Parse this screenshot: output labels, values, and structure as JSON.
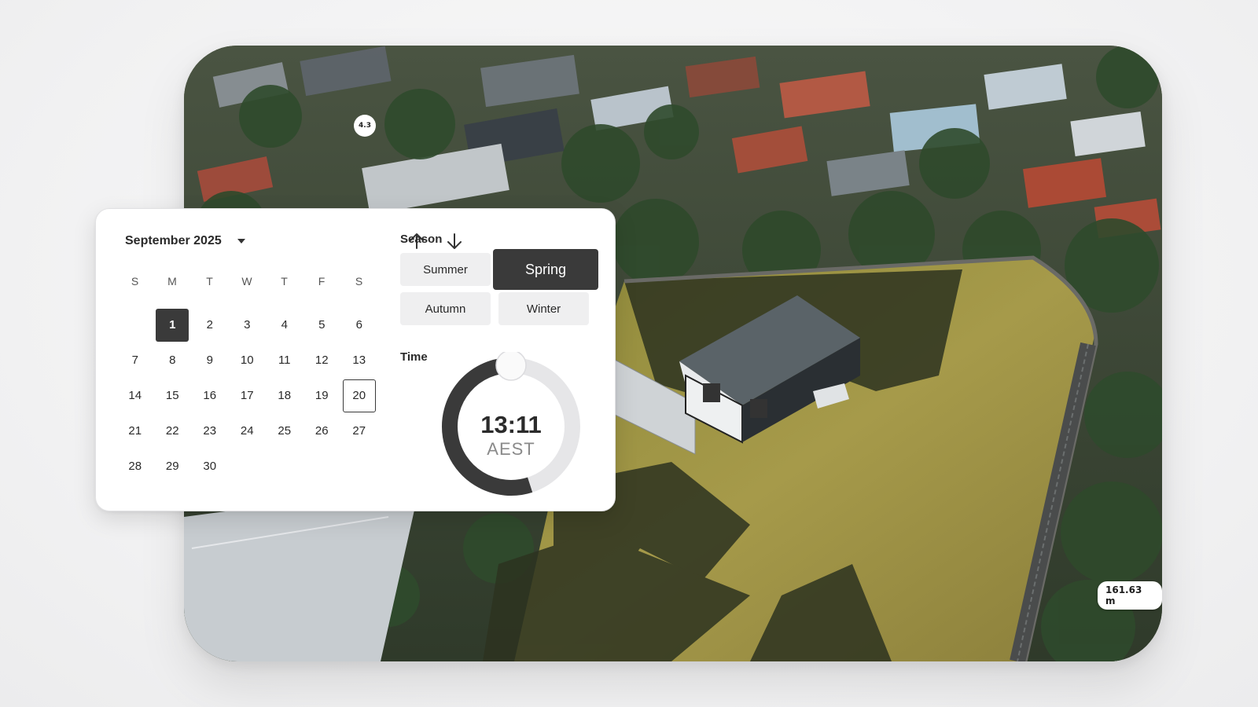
{
  "map": {
    "scale_label": "161.63 m",
    "marker_label": "4.3"
  },
  "calendar": {
    "month_label": "September 2025",
    "weekdays": [
      "S",
      "M",
      "T",
      "W",
      "T",
      "F",
      "S"
    ],
    "leading_blanks": 1,
    "days": [
      "1",
      "2",
      "3",
      "4",
      "5",
      "6",
      "7",
      "8",
      "9",
      "10",
      "11",
      "12",
      "13",
      "14",
      "15",
      "16",
      "17",
      "18",
      "19",
      "20",
      "21",
      "22",
      "23",
      "24",
      "25",
      "26",
      "27",
      "28",
      "29",
      "30"
    ],
    "selected_day": "1",
    "today_day": "20"
  },
  "season": {
    "label": "Season",
    "options": [
      "Summer",
      "Spring",
      "Autumn",
      "Winter"
    ],
    "selected": "Spring"
  },
  "time": {
    "label": "Time",
    "value": "13:11",
    "zone": "AEST",
    "progress": 0.55
  },
  "colors": {
    "accent_dark": "#3a3a3a",
    "button_bg": "#efeff0",
    "track": "#e6e6e8"
  }
}
